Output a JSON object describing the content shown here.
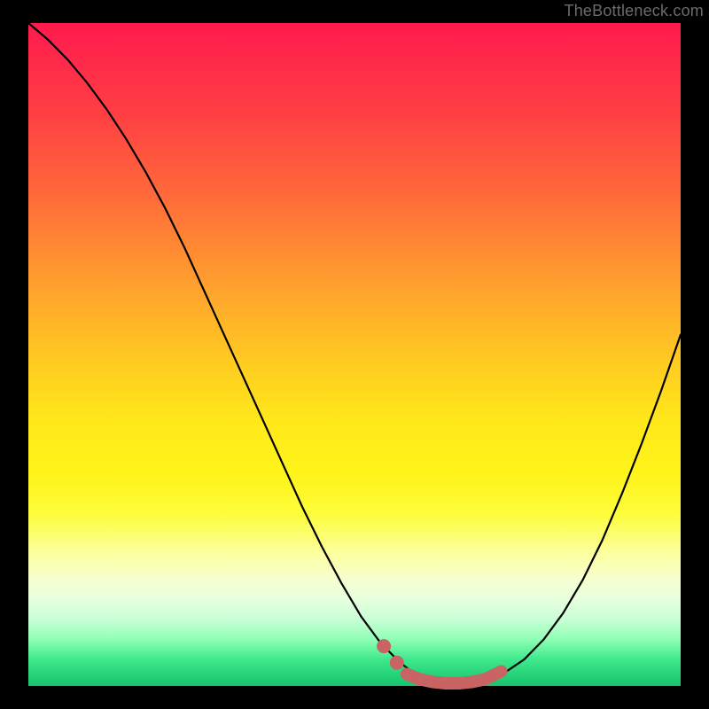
{
  "watermark": "TheBottleneck.com",
  "colors": {
    "curve": "#000000",
    "highlight": "#c86464",
    "highlight_dot": "#c86464"
  },
  "chart_data": {
    "type": "line",
    "title": "",
    "xlabel": "",
    "ylabel": "",
    "xlim": [
      0,
      100
    ],
    "ylim": [
      0,
      100
    ],
    "grid": false,
    "legend": false,
    "series": [
      {
        "name": "bottleneck-curve",
        "x": [
          0,
          3,
          6,
          9,
          12,
          15,
          18,
          21,
          24,
          27,
          30,
          33,
          36,
          39,
          42,
          45,
          48,
          51,
          54,
          57,
          59,
          61,
          63,
          65,
          67,
          69,
          71,
          73,
          76,
          79,
          82,
          85,
          88,
          91,
          94,
          97,
          100
        ],
        "y": [
          100,
          97.5,
          94.5,
          91,
          87,
          82.5,
          77.5,
          72,
          66,
          59.5,
          53,
          46.5,
          40,
          33.5,
          27,
          21,
          15.5,
          10.5,
          6.5,
          3.5,
          2,
          1,
          0.5,
          0.3,
          0.3,
          0.5,
          1,
          2,
          4,
          7,
          11,
          16,
          22,
          29,
          36.5,
          44.5,
          53
        ]
      }
    ],
    "highlight": {
      "dots": [
        {
          "x": 54.5,
          "y": 6.0
        },
        {
          "x": 56.5,
          "y": 3.5
        }
      ],
      "stroke_segment": {
        "x": [
          58,
          60,
          62,
          64,
          66,
          68,
          70,
          72.5
        ],
        "y": [
          1.8,
          1.0,
          0.6,
          0.4,
          0.4,
          0.6,
          1.0,
          2.2
        ]
      }
    }
  }
}
